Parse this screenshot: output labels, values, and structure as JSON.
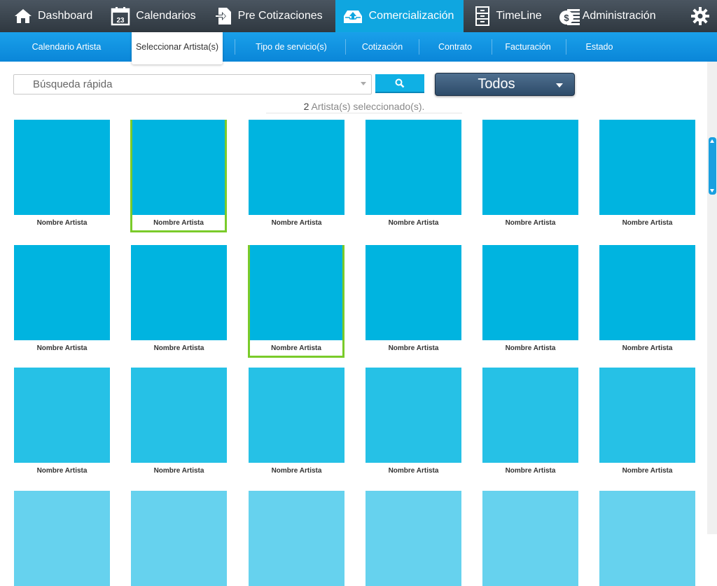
{
  "colors": {
    "topbar": "#3a444d",
    "accent": "#0fa6e0",
    "subbar": "#1294e0",
    "selected_border": "#7acb2a",
    "card_row1": "#00b4e0",
    "card_row2": "#00b4e0",
    "card_row3": "#26c1e6",
    "card_row4": "#66d2ee"
  },
  "topnav": [
    {
      "label": "Dashboard",
      "icon": "home-icon"
    },
    {
      "label": "Calendarios",
      "icon": "calendar-icon",
      "icon_text": "23"
    },
    {
      "label": "Pre Cotizaciones",
      "icon": "document-arrow-icon"
    },
    {
      "label": "Comercialización",
      "icon": "inbox-upload-icon",
      "active": true
    },
    {
      "label": "TimeLine",
      "icon": "cabinet-icon"
    },
    {
      "label": "Administración",
      "icon": "coins-icon"
    }
  ],
  "settings_icon": "gear-icon",
  "subnav": [
    {
      "label": "Calendario Artista"
    },
    {
      "label": "Seleccionar Artista(s)",
      "active": true
    },
    {
      "label": "Tipo de servicio(s)"
    },
    {
      "label": "Cotización"
    },
    {
      "label": "Contrato"
    },
    {
      "label": "Facturación"
    },
    {
      "label": "Estado"
    }
  ],
  "search": {
    "placeholder": "Búsqueda rápida",
    "value": "",
    "button_icon": "search-icon"
  },
  "filter": {
    "selected": "Todos"
  },
  "selection": {
    "count": "2",
    "text": " Artista(s) seleccionado(s)."
  },
  "artists": [
    {
      "name": "Nombre Artista",
      "selected": false
    },
    {
      "name": "Nombre Artista",
      "selected": true
    },
    {
      "name": "Nombre Artista",
      "selected": false
    },
    {
      "name": "Nombre Artista",
      "selected": false
    },
    {
      "name": "Nombre Artista",
      "selected": false
    },
    {
      "name": "Nombre Artista",
      "selected": false
    },
    {
      "name": "Nombre Artista",
      "selected": false
    },
    {
      "name": "Nombre Artista",
      "selected": false
    },
    {
      "name": "Nombre Artista",
      "selected": true
    },
    {
      "name": "Nombre Artista",
      "selected": false
    },
    {
      "name": "Nombre Artista",
      "selected": false
    },
    {
      "name": "Nombre Artista",
      "selected": false
    },
    {
      "name": "Nombre Artista",
      "selected": false
    },
    {
      "name": "Nombre Artista",
      "selected": false
    },
    {
      "name": "Nombre Artista",
      "selected": false
    },
    {
      "name": "Nombre Artista",
      "selected": false
    },
    {
      "name": "Nombre Artista",
      "selected": false
    },
    {
      "name": "Nombre Artista",
      "selected": false
    },
    {
      "name": "",
      "selected": false
    },
    {
      "name": "",
      "selected": false
    },
    {
      "name": "",
      "selected": false
    },
    {
      "name": "",
      "selected": false
    },
    {
      "name": "",
      "selected": false
    },
    {
      "name": "",
      "selected": false
    }
  ]
}
